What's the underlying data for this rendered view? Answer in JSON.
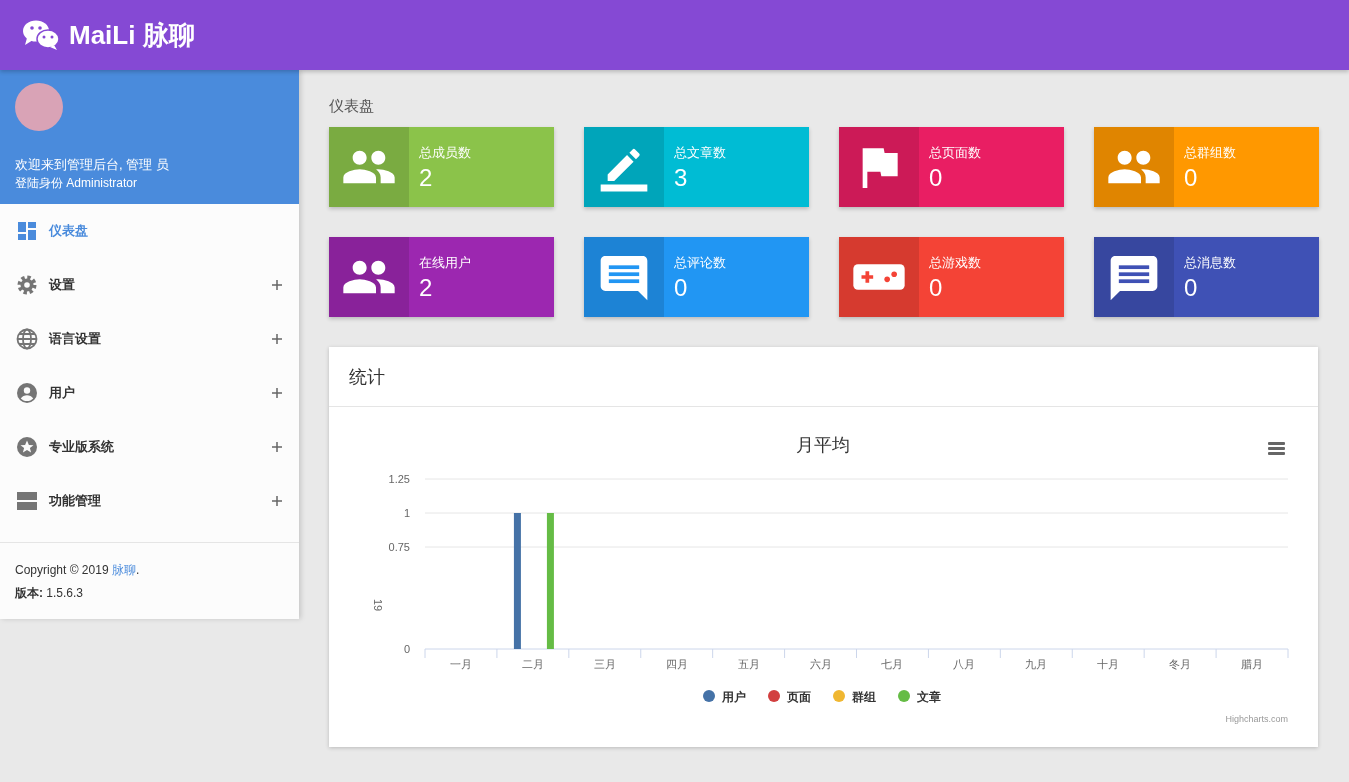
{
  "header": {
    "brand": "MaiLi 脉聊"
  },
  "profile": {
    "welcome": "欢迎来到管理后台, 管理 员",
    "role": "登陆身份 Administrator"
  },
  "menu": [
    {
      "label": "仪表盘",
      "kind": "dashboard",
      "selected": true,
      "expandable": false
    },
    {
      "label": "设置",
      "kind": "gear",
      "selected": false,
      "expandable": true
    },
    {
      "label": "语言设置",
      "kind": "globe",
      "selected": false,
      "expandable": true
    },
    {
      "label": "用户",
      "kind": "person",
      "selected": false,
      "expandable": true
    },
    {
      "label": "专业版系统",
      "kind": "star",
      "selected": false,
      "expandable": true
    },
    {
      "label": "功能管理",
      "kind": "panels",
      "selected": false,
      "expandable": true
    }
  ],
  "footer": {
    "copyright": "Copyright © 2019",
    "link": "脉聊",
    "period": ".",
    "version_label": "版本:",
    "version": "1.5.6.3"
  },
  "page_title": "仪表盘",
  "stat_cards": [
    {
      "label": "总成员数",
      "value": "2",
      "kind": "people",
      "color": "#8bc34a"
    },
    {
      "label": "总文章数",
      "value": "3",
      "kind": "pencil",
      "color": "#00bcd4"
    },
    {
      "label": "总页面数",
      "value": "0",
      "kind": "flag",
      "color": "#e91e63"
    },
    {
      "label": "总群组数",
      "value": "0",
      "kind": "group",
      "color": "#ff9800"
    },
    {
      "label": "在线用户",
      "value": "2",
      "kind": "people",
      "color": "#9c27b0"
    },
    {
      "label": "总评论数",
      "value": "0",
      "kind": "comment",
      "color": "#2196f3"
    },
    {
      "label": "总游戏数",
      "value": "0",
      "kind": "gamepad",
      "color": "#f44336"
    },
    {
      "label": "总消息数",
      "value": "0",
      "kind": "message",
      "color": "#3f51b5"
    }
  ],
  "stats_panel": {
    "title": "统计",
    "credits": "Highcharts.com",
    "chart_data": {
      "type": "bar",
      "title": "月平均",
      "ylabel": "19",
      "categories": [
        "一月",
        "二月",
        "三月",
        "四月",
        "五月",
        "六月",
        "七月",
        "八月",
        "九月",
        "十月",
        "冬月",
        "腊月"
      ],
      "yticks": [
        0,
        0.75,
        1,
        1.25
      ],
      "ylim": [
        0,
        1.25
      ],
      "legend": "bottom",
      "series": [
        {
          "name": "用户",
          "color": "#4572a7",
          "values": [
            0,
            1,
            0,
            0,
            0,
            0,
            0,
            0,
            0,
            0,
            0,
            0
          ]
        },
        {
          "name": "页面",
          "color": "#d23f3f",
          "values": [
            0,
            0,
            0,
            0,
            0,
            0,
            0,
            0,
            0,
            0,
            0,
            0
          ]
        },
        {
          "name": "群组",
          "color": "#f0b731",
          "values": [
            0,
            0,
            0,
            0,
            0,
            0,
            0,
            0,
            0,
            0,
            0,
            0
          ]
        },
        {
          "name": "文章",
          "color": "#65bc45",
          "values": [
            0,
            1,
            0,
            0,
            0,
            0,
            0,
            0,
            0,
            0,
            0,
            0
          ]
        }
      ]
    }
  }
}
